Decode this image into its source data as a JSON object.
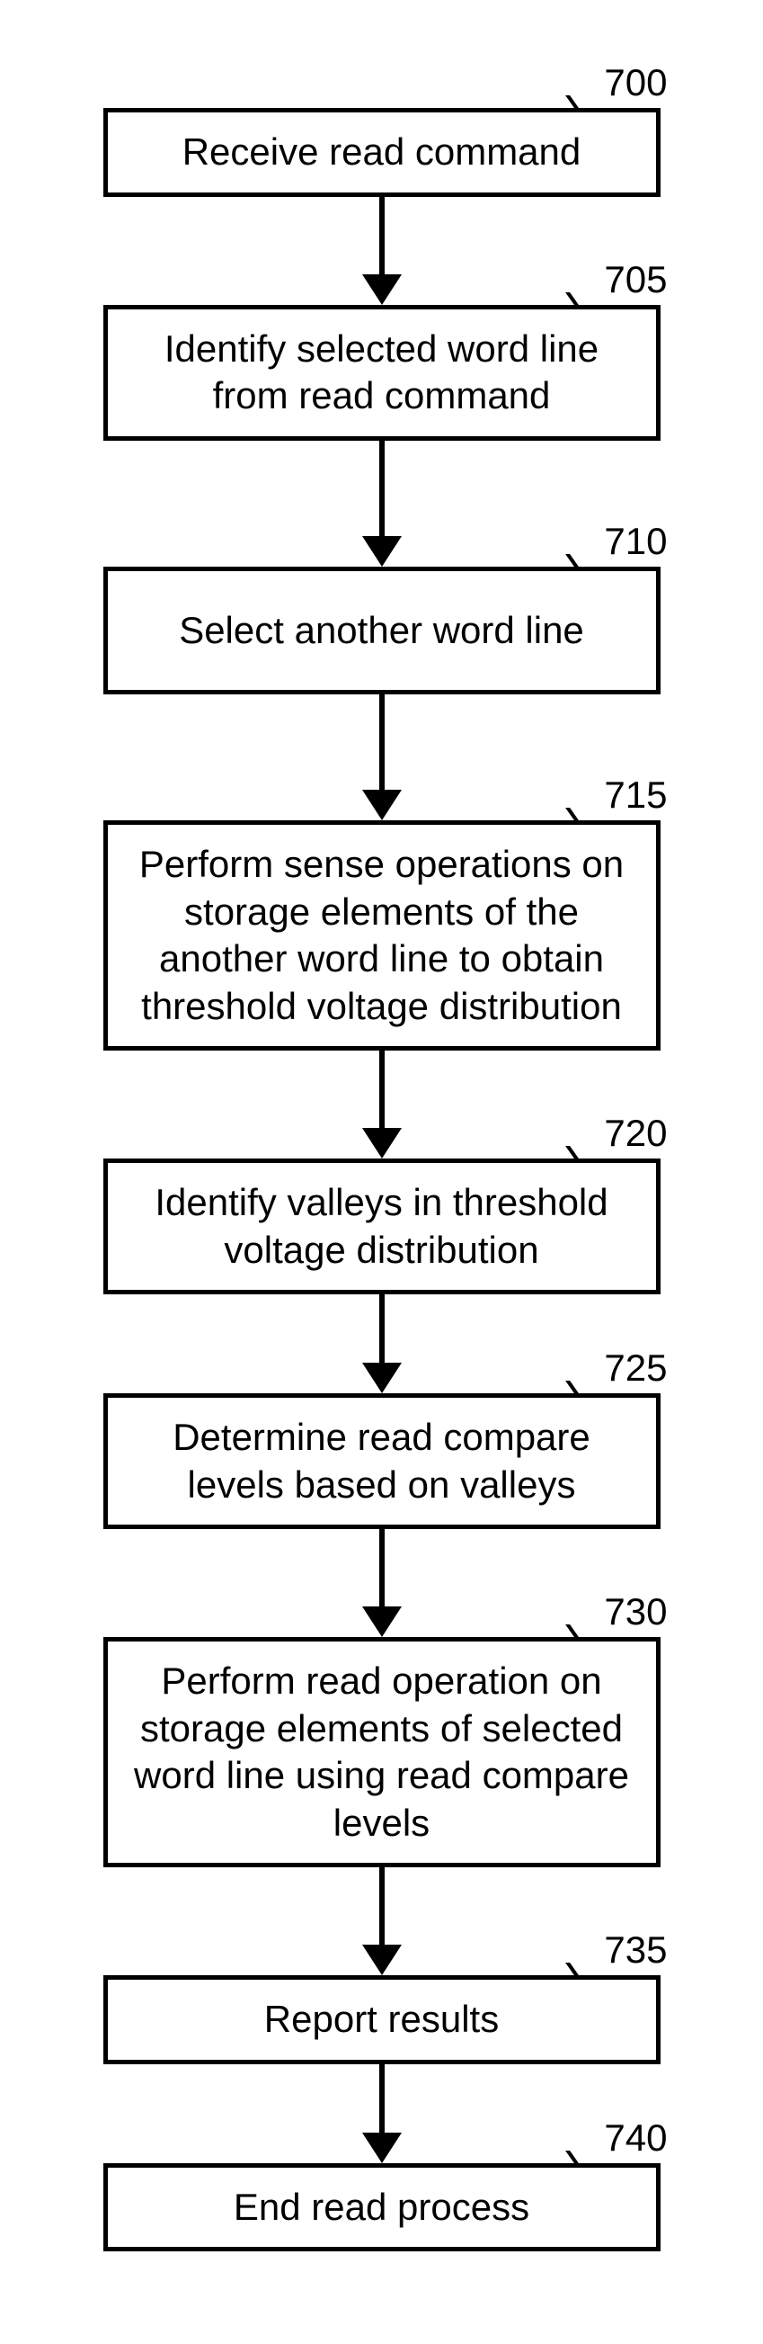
{
  "flowchart": {
    "steps": [
      {
        "ref": "700",
        "text": "Receive read command"
      },
      {
        "ref": "705",
        "text": "Identify selected word line from read command"
      },
      {
        "ref": "710",
        "text": "Select another word line"
      },
      {
        "ref": "715",
        "text": "Perform sense operations on storage elements of the another word line to obtain threshold voltage distribution"
      },
      {
        "ref": "720",
        "text": "Identify valleys in threshold voltage distribution"
      },
      {
        "ref": "725",
        "text": "Determine read compare levels based on valleys"
      },
      {
        "ref": "730",
        "text": "Perform read operation on storage elements of selected word line using read compare levels"
      },
      {
        "ref": "735",
        "text": "Report results"
      },
      {
        "ref": "740",
        "text": "End read process"
      }
    ]
  }
}
